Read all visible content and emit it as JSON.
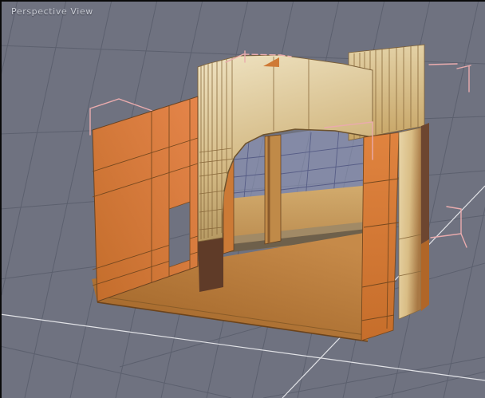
{
  "viewport": {
    "label": "Perspective View"
  },
  "colors": {
    "bg": "#6f7280",
    "grid": "#5c606e",
    "axis": "#e2e3e7",
    "label": "#c9ccd4",
    "border": "#0a0a0a",
    "pink": "#eaabad",
    "orange_bright": "#e08343",
    "orange_dark": "#c06c2a",
    "tan_light": "#efe3c2",
    "tan_dark": "#b2955e",
    "floor": "#b97c3e",
    "step": "#6e604b",
    "shadow": "#5f3b28",
    "glass": "#969ec4"
  }
}
